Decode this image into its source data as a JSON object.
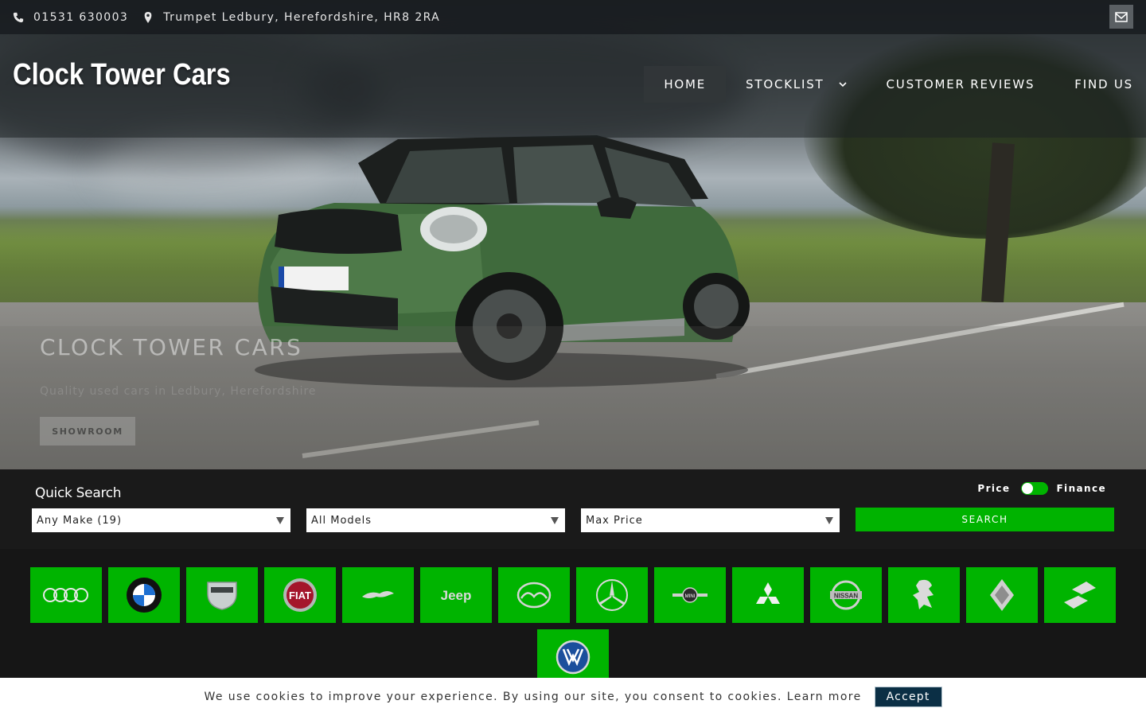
{
  "topbar": {
    "phone": "01531 630003",
    "address": "Trumpet Ledbury, Herefordshire, HR8 2RA",
    "phone_icon": "phone-icon",
    "address_icon": "map-pin-icon",
    "mail_icon": "envelope-icon"
  },
  "header": {
    "logo": "Clock Tower Cars",
    "nav": [
      {
        "label": "HOME",
        "active": true
      },
      {
        "label": "STOCKLIST",
        "has_dropdown": true
      },
      {
        "label": "CUSTOMER REVIEWS"
      },
      {
        "label": "FIND US"
      }
    ]
  },
  "hero": {
    "title": "CLOCK TOWER CARS",
    "subtitle": "Quality used cars in Ledbury, Herefordshire",
    "cta": "SHOWROOM"
  },
  "quick_search": {
    "title": "Quick Search",
    "toggle_left": "Price",
    "toggle_right": "Finance",
    "make_select": "Any Make (19)",
    "model_select": "All Models",
    "price_select": "Max Price",
    "search_label": "SEARCH"
  },
  "makes": [
    "Audi",
    "BMW",
    "Dacia",
    "Fiat",
    "Jaguar",
    "Jeep",
    "Mazda",
    "Mercedes-Benz",
    "MINI",
    "Mitsubishi",
    "Nissan",
    "Peugeot",
    "Renault",
    "Suzuki",
    "Volkswagen"
  ],
  "cookie": {
    "message": "We use cookies to improve your experience. By using our site, you consent to cookies.",
    "learn_more": "Learn more",
    "accept": "Accept"
  },
  "colors": {
    "brand_green": "#00b400",
    "accept_navy": "#0b2f45"
  }
}
